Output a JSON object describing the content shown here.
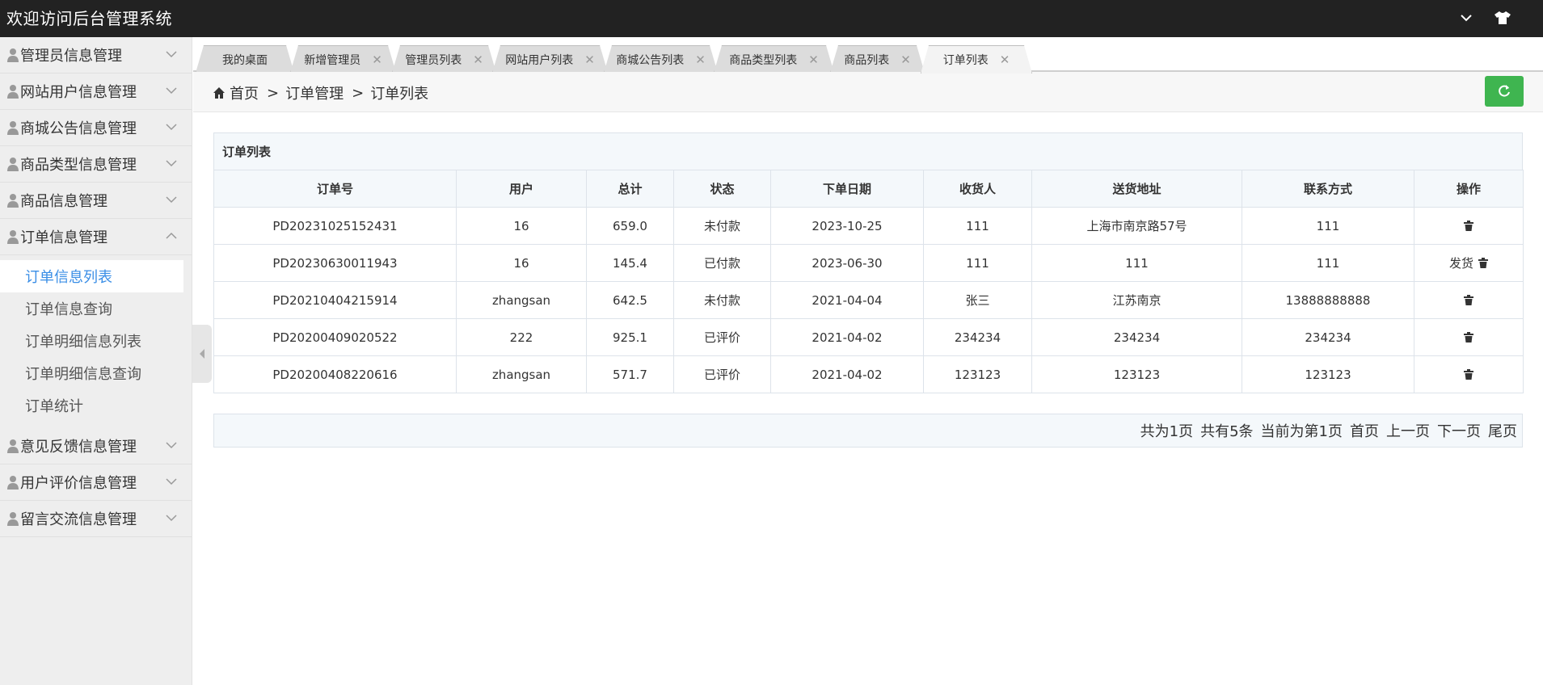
{
  "header": {
    "title": "欢迎访问后台管理系统",
    "icons": [
      "chevron-down-icon",
      "shirt-icon"
    ]
  },
  "sidebar": {
    "groups_before": [
      {
        "label": "管理员信息管理"
      },
      {
        "label": "网站用户信息管理"
      },
      {
        "label": "商城公告信息管理"
      },
      {
        "label": "商品类型信息管理"
      },
      {
        "label": "商品信息管理"
      }
    ],
    "open_group": {
      "label": "订单信息管理",
      "items": [
        {
          "label": "订单信息列表"
        },
        {
          "label": "订单信息查询"
        },
        {
          "label": "订单明细信息列表"
        },
        {
          "label": "订单明细信息查询"
        },
        {
          "label": "订单统计"
        }
      ]
    },
    "groups_after": [
      {
        "label": "意见反馈信息管理"
      },
      {
        "label": "用户评价信息管理"
      },
      {
        "label": "留言交流信息管理"
      }
    ]
  },
  "tabs": [
    {
      "label": "我的桌面",
      "closable": false
    },
    {
      "label": "新增管理员",
      "closable": true
    },
    {
      "label": "管理员列表",
      "closable": true
    },
    {
      "label": "网站用户列表",
      "closable": true
    },
    {
      "label": "商城公告列表",
      "closable": true
    },
    {
      "label": "商品类型列表",
      "closable": true
    },
    {
      "label": "商品列表",
      "closable": true
    },
    {
      "label": "订单列表",
      "closable": true,
      "active": true
    }
  ],
  "breadcrumb": {
    "home": "首页",
    "sep": ">",
    "level1": "订单管理",
    "level2": "订单列表"
  },
  "table": {
    "caption": "订单列表",
    "columns": [
      "订单号",
      "用户",
      "总计",
      "状态",
      "下单日期",
      "收货人",
      "送货地址",
      "联系方式",
      "操作"
    ],
    "rows": [
      {
        "cells": [
          "PD20231025152431",
          "16",
          "659.0",
          "未付款",
          "2023-10-25",
          "111",
          "上海市南京路57号",
          "111"
        ],
        "ship": ""
      },
      {
        "cells": [
          "PD20230630011943",
          "16",
          "145.4",
          "已付款",
          "2023-06-30",
          "111",
          "111",
          "111"
        ],
        "ship": "发货"
      },
      {
        "cells": [
          "PD20210404215914",
          "zhangsan",
          "642.5",
          "未付款",
          "2021-04-04",
          "张三",
          "江苏南京",
          "13888888888"
        ],
        "ship": ""
      },
      {
        "cells": [
          "PD20200409020522",
          "222",
          "925.1",
          "已评价",
          "2021-04-02",
          "234234",
          "234234",
          "234234"
        ],
        "ship": ""
      },
      {
        "cells": [
          "PD20200408220616",
          "zhangsan",
          "571.7",
          "已评价",
          "2021-04-02",
          "123123",
          "123123",
          "123123"
        ],
        "ship": ""
      }
    ]
  },
  "pager": {
    "total_pages": "共为1页",
    "total_rows": "共有5条",
    "current": "当前为第1页",
    "first": "首页",
    "prev": "上一页",
    "next": "下一页",
    "last": "尾页"
  },
  "colors": {
    "header_bg": "#222222",
    "accent": "#3a8ee6",
    "refresh_btn": "#3fb550"
  }
}
